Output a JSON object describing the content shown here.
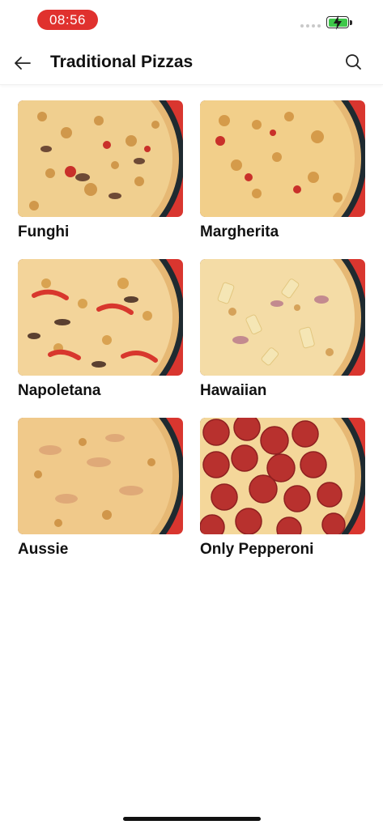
{
  "status_bar": {
    "time": "08:56"
  },
  "header": {
    "title": "Traditional Pizzas"
  },
  "icons": {
    "back": "arrow-left-icon",
    "search": "search-icon",
    "battery": "battery-charging-icon"
  },
  "colors": {
    "accent": "#e0312e",
    "battery": "#3ec74a"
  },
  "pizzas": [
    {
      "name": "Funghi",
      "image": "funghi pizza photo"
    },
    {
      "name": "Margherita",
      "image": "margherita pizza photo"
    },
    {
      "name": "Napoletana",
      "image": "napoletana pizza photo"
    },
    {
      "name": "Hawaiian",
      "image": "hawaiian pizza photo"
    },
    {
      "name": "Aussie",
      "image": "aussie pizza photo"
    },
    {
      "name": "Only Pepperoni",
      "image": "pepperoni pizza photo"
    }
  ]
}
